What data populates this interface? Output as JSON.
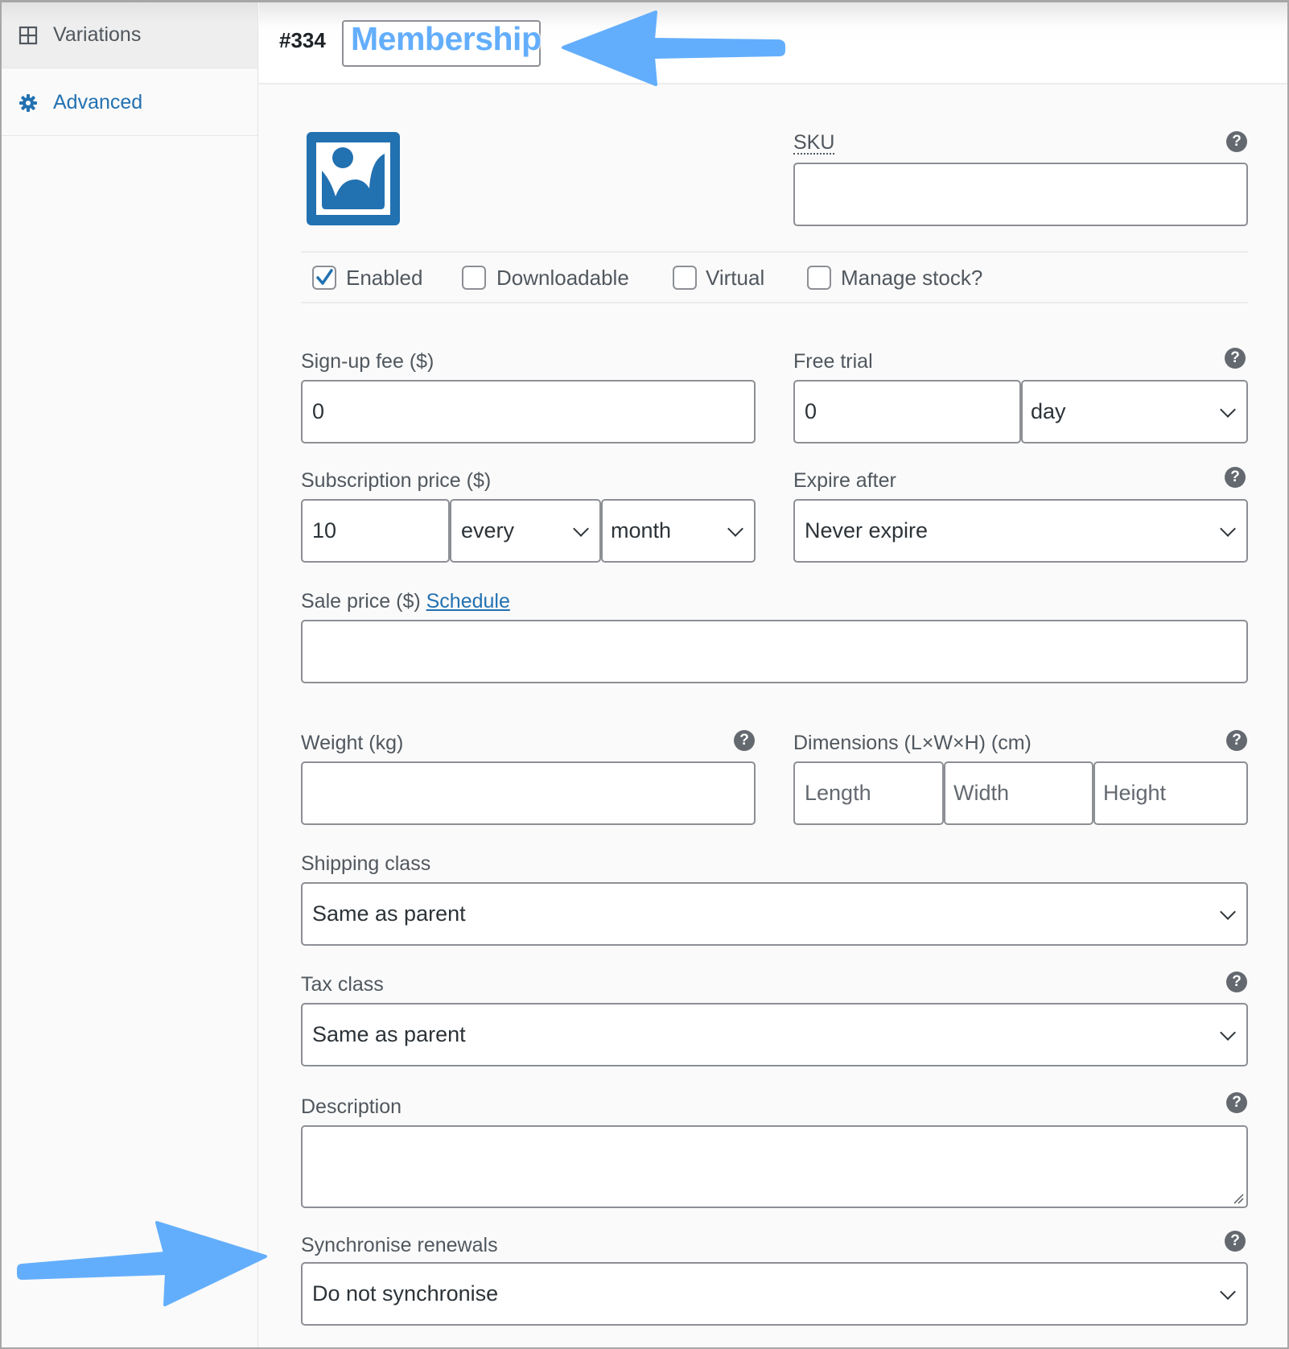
{
  "sidebar": {
    "items": [
      {
        "label": "Variations",
        "icon": "grid-icon",
        "active": false
      },
      {
        "label": "Advanced",
        "icon": "gear-icon",
        "active": true
      }
    ]
  },
  "header": {
    "variation_id": "#334",
    "variation_name": "Membership"
  },
  "image": {
    "icon": "image-placeholder-icon"
  },
  "sku": {
    "label": "SKU",
    "value": "",
    "help": "?"
  },
  "options": [
    {
      "label": "Enabled",
      "checked": true
    },
    {
      "label": "Downloadable",
      "checked": false
    },
    {
      "label": "Virtual",
      "checked": false
    },
    {
      "label": "Manage stock?",
      "checked": false
    }
  ],
  "signup_fee": {
    "label": "Sign-up fee ($)",
    "value": "0"
  },
  "free_trial": {
    "label": "Free trial",
    "value": "0",
    "period": "day",
    "help": "?"
  },
  "subscription_price": {
    "label": "Subscription price ($)",
    "value": "10",
    "interval": "every",
    "period": "month"
  },
  "expire_after": {
    "label": "Expire after",
    "value": "Never expire",
    "help": "?"
  },
  "sale_price": {
    "label": "Sale price ($)",
    "link": "Schedule",
    "value": ""
  },
  "weight": {
    "label": "Weight (kg)",
    "value": "",
    "help": "?"
  },
  "dimensions": {
    "label": "Dimensions (L×W×H) (cm)",
    "length_placeholder": "Length",
    "width_placeholder": "Width",
    "height_placeholder": "Height",
    "help": "?"
  },
  "shipping_class": {
    "label": "Shipping class",
    "value": "Same as parent"
  },
  "tax_class": {
    "label": "Tax class",
    "value": "Same as parent",
    "help": "?"
  },
  "description": {
    "label": "Description",
    "value": "",
    "help": "?"
  },
  "synchronise": {
    "label": "Synchronise renewals",
    "value": "Do not synchronise",
    "help": "?"
  },
  "colors": {
    "accent": "#2271b1",
    "annotation_arrow": "#63aefc",
    "help_icon": "#646970"
  }
}
